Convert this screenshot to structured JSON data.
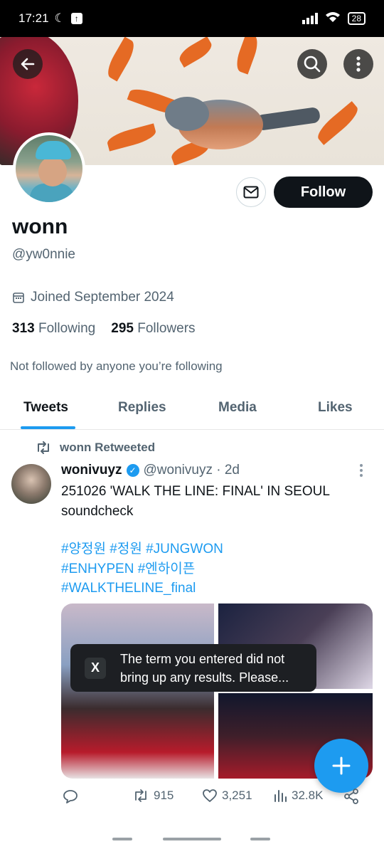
{
  "status_bar": {
    "time": "17:21",
    "battery": "28"
  },
  "profile": {
    "name": "wonn",
    "handle": "@yw0nnie",
    "joined": "Joined September 2024",
    "following_count": "313",
    "following_label": "Following",
    "followers_count": "295",
    "followers_label": "Followers",
    "not_followed": "Not followed by anyone you’re following",
    "follow_label": "Follow"
  },
  "tabs": [
    {
      "label": "Tweets"
    },
    {
      "label": "Replies"
    },
    {
      "label": "Media"
    },
    {
      "label": "Likes"
    }
  ],
  "tweet": {
    "retweet_label": "wonn Retweeted",
    "display_name": "wonivuyz",
    "meta": "@wonivuyz · 2d",
    "text_line1": "251026 'WALK THE LINE: FINAL' IN SEOUL",
    "text_line2": "soundcheck",
    "hashtags_line1": "#양정원 #정원 #JUNGWON",
    "hashtags_line2": "#ENHYPEN #엔하이픈",
    "hashtags_line3": "#WALKTHELINE_final",
    "retweets": "915",
    "likes": "3,251",
    "views": "32.8K"
  },
  "toast": {
    "icon": "X",
    "message": "The term you entered did not bring up any results. Please..."
  },
  "colors": {
    "accent": "#1d9bf0",
    "text": "#0f1419",
    "muted": "#536471"
  }
}
